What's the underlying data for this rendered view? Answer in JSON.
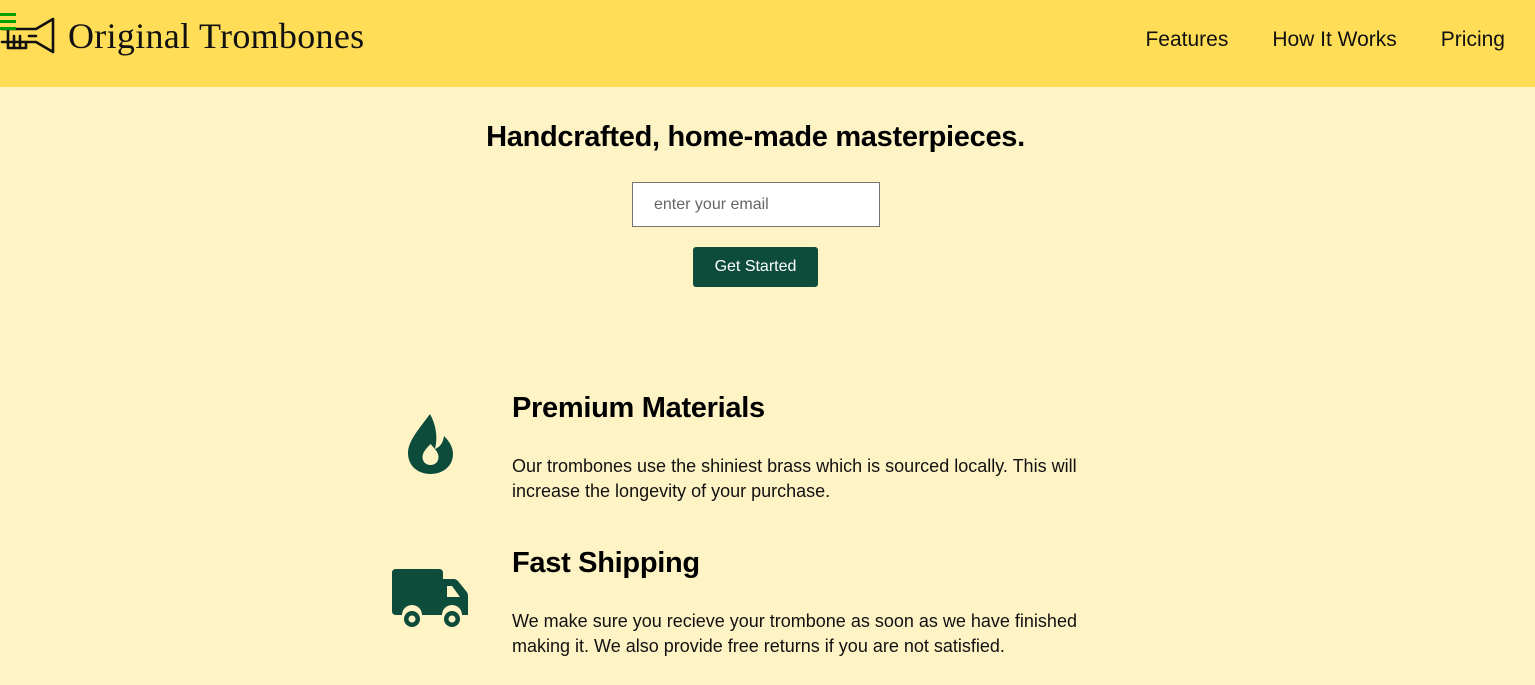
{
  "brand": {
    "name": "Original Trombones",
    "logo_icon": "trombone-logo-icon",
    "menu_icon": "hamburger-menu-icon"
  },
  "nav": {
    "items": [
      {
        "label": "Features"
      },
      {
        "label": "How It Works"
      },
      {
        "label": "Pricing"
      }
    ]
  },
  "hero": {
    "title": "Handcrafted, home-made masterpieces.",
    "email_placeholder": "enter your email",
    "email_value": "",
    "cta_label": "Get Started"
  },
  "features": [
    {
      "icon": "flame-icon",
      "title": "Premium Materials",
      "description": "Our trombones use the shiniest brass which is sourced locally. This will increase the longevity of your purchase."
    },
    {
      "icon": "truck-icon",
      "title": "Fast Shipping",
      "description": "We make sure you recieve your trombone as soon as we have finished making it. We also provide free returns if you are not satisfied."
    }
  ],
  "colors": {
    "header_bg": "#ffdd57",
    "page_bg": "#fef3c5",
    "accent_green": "#0d4c3b",
    "menu_icon_green": "#00a000"
  }
}
